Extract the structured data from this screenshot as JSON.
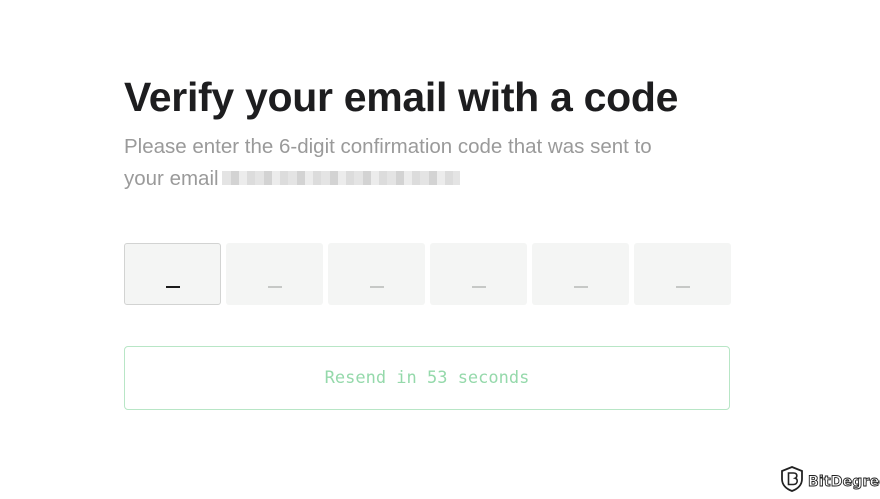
{
  "heading": {
    "title": "Verify your email with a code",
    "subtitle_line1": "Please enter the 6-digit confirmation code that was sent to",
    "subtitle_line2": "your email"
  },
  "code_inputs": [
    {
      "placeholder": "_",
      "focused": true
    },
    {
      "placeholder": "_",
      "focused": false
    },
    {
      "placeholder": "_",
      "focused": false
    },
    {
      "placeholder": "_",
      "focused": false
    },
    {
      "placeholder": "_",
      "focused": false
    },
    {
      "placeholder": "_",
      "focused": false
    }
  ],
  "resend": {
    "label": "Resend in 53 seconds",
    "enabled": false
  },
  "watermark": {
    "brand": "BitDegree",
    "icon": "bitdegree-shield-logo"
  },
  "colors": {
    "title": "#1d1d1f",
    "subtitle": "#9a9a9a",
    "input_bg": "#f4f5f4",
    "resend_border": "#b8e6c6",
    "resend_text": "#95d9ab"
  }
}
